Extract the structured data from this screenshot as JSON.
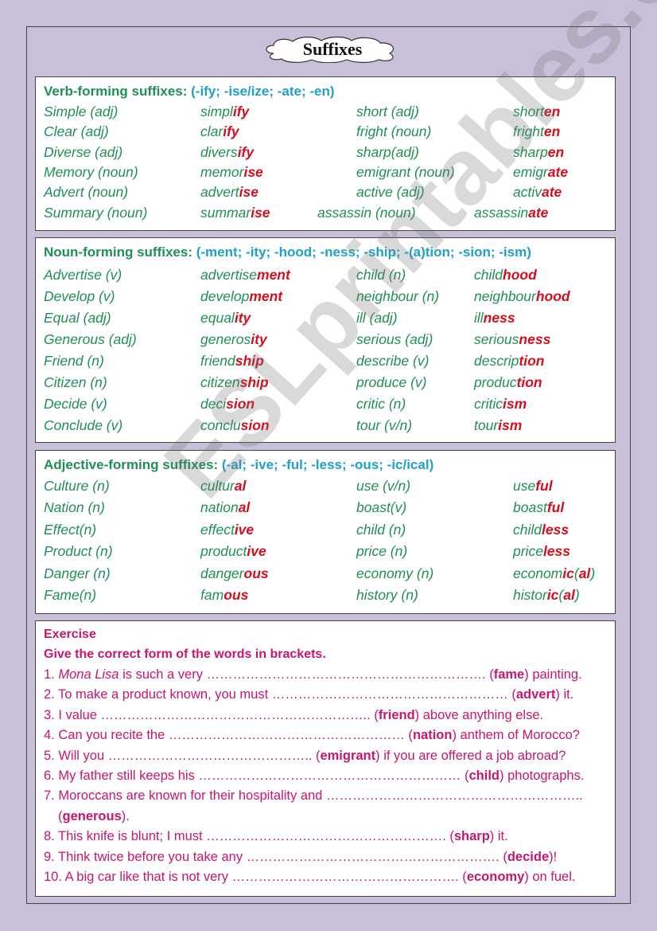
{
  "title": "Suffixes",
  "colors": {
    "heading_green": "#1f8f55",
    "suffix_blue": "#1ea0c8",
    "suffix_red": "#d40e1e",
    "exercise_pink": "#c8156e",
    "background": "#c9bfd9"
  },
  "verb": {
    "heading": "Verb-forming suffixes: ",
    "suffixes": "(-ify; -ise/ize; -ate; -en)",
    "rows": [
      [
        [
          "Simple (adj)",
          ""
        ],
        [
          "simpl",
          "ify"
        ],
        [
          "short (adj)",
          ""
        ],
        [
          "short",
          "en"
        ]
      ],
      [
        [
          "Clear (adj)",
          ""
        ],
        [
          "clar",
          "ify"
        ],
        [
          "fright (noun)",
          ""
        ],
        [
          "fright",
          "en"
        ]
      ],
      [
        [
          "Diverse (adj)",
          ""
        ],
        [
          "divers",
          "ify"
        ],
        [
          "sharp(adj)",
          ""
        ],
        [
          "sharp",
          "en"
        ]
      ],
      [
        [
          "Memory (noun)",
          ""
        ],
        [
          "memor",
          "ise"
        ],
        [
          "emigrant (noun)",
          ""
        ],
        [
          "emigr",
          "ate"
        ]
      ],
      [
        [
          "Advert (noun)",
          ""
        ],
        [
          "advert",
          "ise"
        ],
        [
          "active (adj)",
          ""
        ],
        [
          "activ",
          "ate"
        ]
      ],
      [
        [
          "Summary (noun)",
          ""
        ],
        [
          "summar",
          "ise"
        ],
        [
          "assassin (noun)",
          ""
        ],
        [
          "assassin",
          "ate"
        ]
      ]
    ]
  },
  "noun": {
    "heading": "Noun-forming suffixes: ",
    "suffixes": "(-ment; -ity; -hood; -ness; -ship; -(a)tion; -sion; -ism)",
    "rows": [
      [
        [
          "Advertise (v)",
          ""
        ],
        [
          "advertise",
          "ment"
        ],
        [
          "child (n)",
          ""
        ],
        [
          "child",
          "hood"
        ]
      ],
      [
        [
          "Develop (v)",
          ""
        ],
        [
          "develop",
          "ment"
        ],
        [
          "neighbour (n)",
          ""
        ],
        [
          "neighbour",
          "hood"
        ]
      ],
      [
        [
          "Equal (adj)",
          ""
        ],
        [
          "equal",
          "ity"
        ],
        [
          "ill (adj)",
          ""
        ],
        [
          "ill",
          "ness"
        ]
      ],
      [
        [
          "Generous (adj)",
          ""
        ],
        [
          "generos",
          "ity"
        ],
        [
          "serious (adj)",
          ""
        ],
        [
          "serious",
          "ness"
        ]
      ],
      [
        [
          "Friend (n)",
          ""
        ],
        [
          "friend",
          "ship"
        ],
        [
          "describe (v)",
          ""
        ],
        [
          "descrip",
          "tion"
        ]
      ],
      [
        [
          "Citizen (n)",
          ""
        ],
        [
          "citizen",
          "ship"
        ],
        [
          "produce (v)",
          ""
        ],
        [
          "produc",
          "tion"
        ]
      ],
      [
        [
          "Decide (v)",
          ""
        ],
        [
          "deci",
          "sion"
        ],
        [
          "critic (n)",
          ""
        ],
        [
          "critic",
          "ism"
        ]
      ],
      [
        [
          "Conclude (v)",
          ""
        ],
        [
          "conclu",
          "sion"
        ],
        [
          "tour (v/n)",
          ""
        ],
        [
          "tour",
          "ism"
        ]
      ]
    ]
  },
  "adjective": {
    "heading": "Adjective-forming suffixes: ",
    "suffixes": "(-al; -ive; -ful; -less; -ous; -ic/ical)",
    "rows": [
      [
        [
          "Culture (n)",
          ""
        ],
        [
          "cultur",
          "al"
        ],
        [
          "use (v/n)",
          ""
        ],
        [
          "use",
          "ful"
        ]
      ],
      [
        [
          "Nation (n)",
          ""
        ],
        [
          "nation",
          "al"
        ],
        [
          "boast(v)",
          ""
        ],
        [
          "boast",
          "ful"
        ]
      ],
      [
        [
          "Effect(n)",
          ""
        ],
        [
          "effect",
          "ive"
        ],
        [
          "child (n)",
          ""
        ],
        [
          "child",
          "less"
        ]
      ],
      [
        [
          "Product (n)",
          ""
        ],
        [
          "product",
          "ive"
        ],
        [
          "price  (n)",
          ""
        ],
        [
          "price",
          "less"
        ]
      ],
      [
        [
          "Danger (n)",
          ""
        ],
        [
          "danger",
          "ous"
        ],
        [
          "economy (n)",
          ""
        ],
        [
          "economic(al)",
          ""
        ]
      ],
      [
        [
          "Fame(n)",
          ""
        ],
        [
          "fam",
          "ous"
        ],
        [
          "history (n)",
          ""
        ],
        [
          "historic(al)",
          ""
        ]
      ]
    ]
  },
  "exercise": {
    "title": "Exercise",
    "instruction": "Give the correct form of the words in brackets.",
    "items": [
      {
        "pre": "1. ",
        "italic": "Mona Lisa",
        "text": " is such a very ………………………………………………………. (",
        "word": "fame",
        "post": ") painting."
      },
      {
        "pre": "2. ",
        "italic": "",
        "text": "To make a product known, you must ……………………………………………… (",
        "word": "advert",
        "post": ") it."
      },
      {
        "pre": "3. ",
        "italic": "",
        "text": "I value …………………………………………………….. (",
        "word": "friend",
        "post": ") above anything else."
      },
      {
        "pre": "4. ",
        "italic": "",
        "text": "Can you recite the ……………………………………………… (",
        "word": "nation",
        "post": ") anthem of Morocco?"
      },
      {
        "pre": "5. ",
        "italic": "",
        "text": "Will you ……………………………………….. (",
        "word": "emigrant",
        "post": ") if you are offered a job abroad?"
      },
      {
        "pre": "6. ",
        "italic": "",
        "text": "My father still keeps his …………………………………………………… (",
        "word": "child",
        "post": ") photographs."
      },
      {
        "pre": "7. ",
        "italic": "",
        "text": "Moroccans are known for their hospitality and …………………………………………………..",
        "word": "",
        "post": ""
      },
      {
        "pre": "   ",
        "italic": "",
        "text": "(",
        "word": "generous",
        "post": ")."
      },
      {
        "pre": "8. ",
        "italic": "",
        "text": "This knife is blunt; I must ………………………………………………. (",
        "word": "sharp",
        "post": ") it."
      },
      {
        "pre": "9. ",
        "italic": "",
        "text": "Think twice before you take any …………………………………………………. (",
        "word": "decide",
        "post": ")!"
      },
      {
        "pre": "10. ",
        "italic": "",
        "text": "A big car like that is not very ……………………………………………. (",
        "word": "economy",
        "post": ") on fuel."
      }
    ]
  },
  "watermark": "ESLprintables.com"
}
